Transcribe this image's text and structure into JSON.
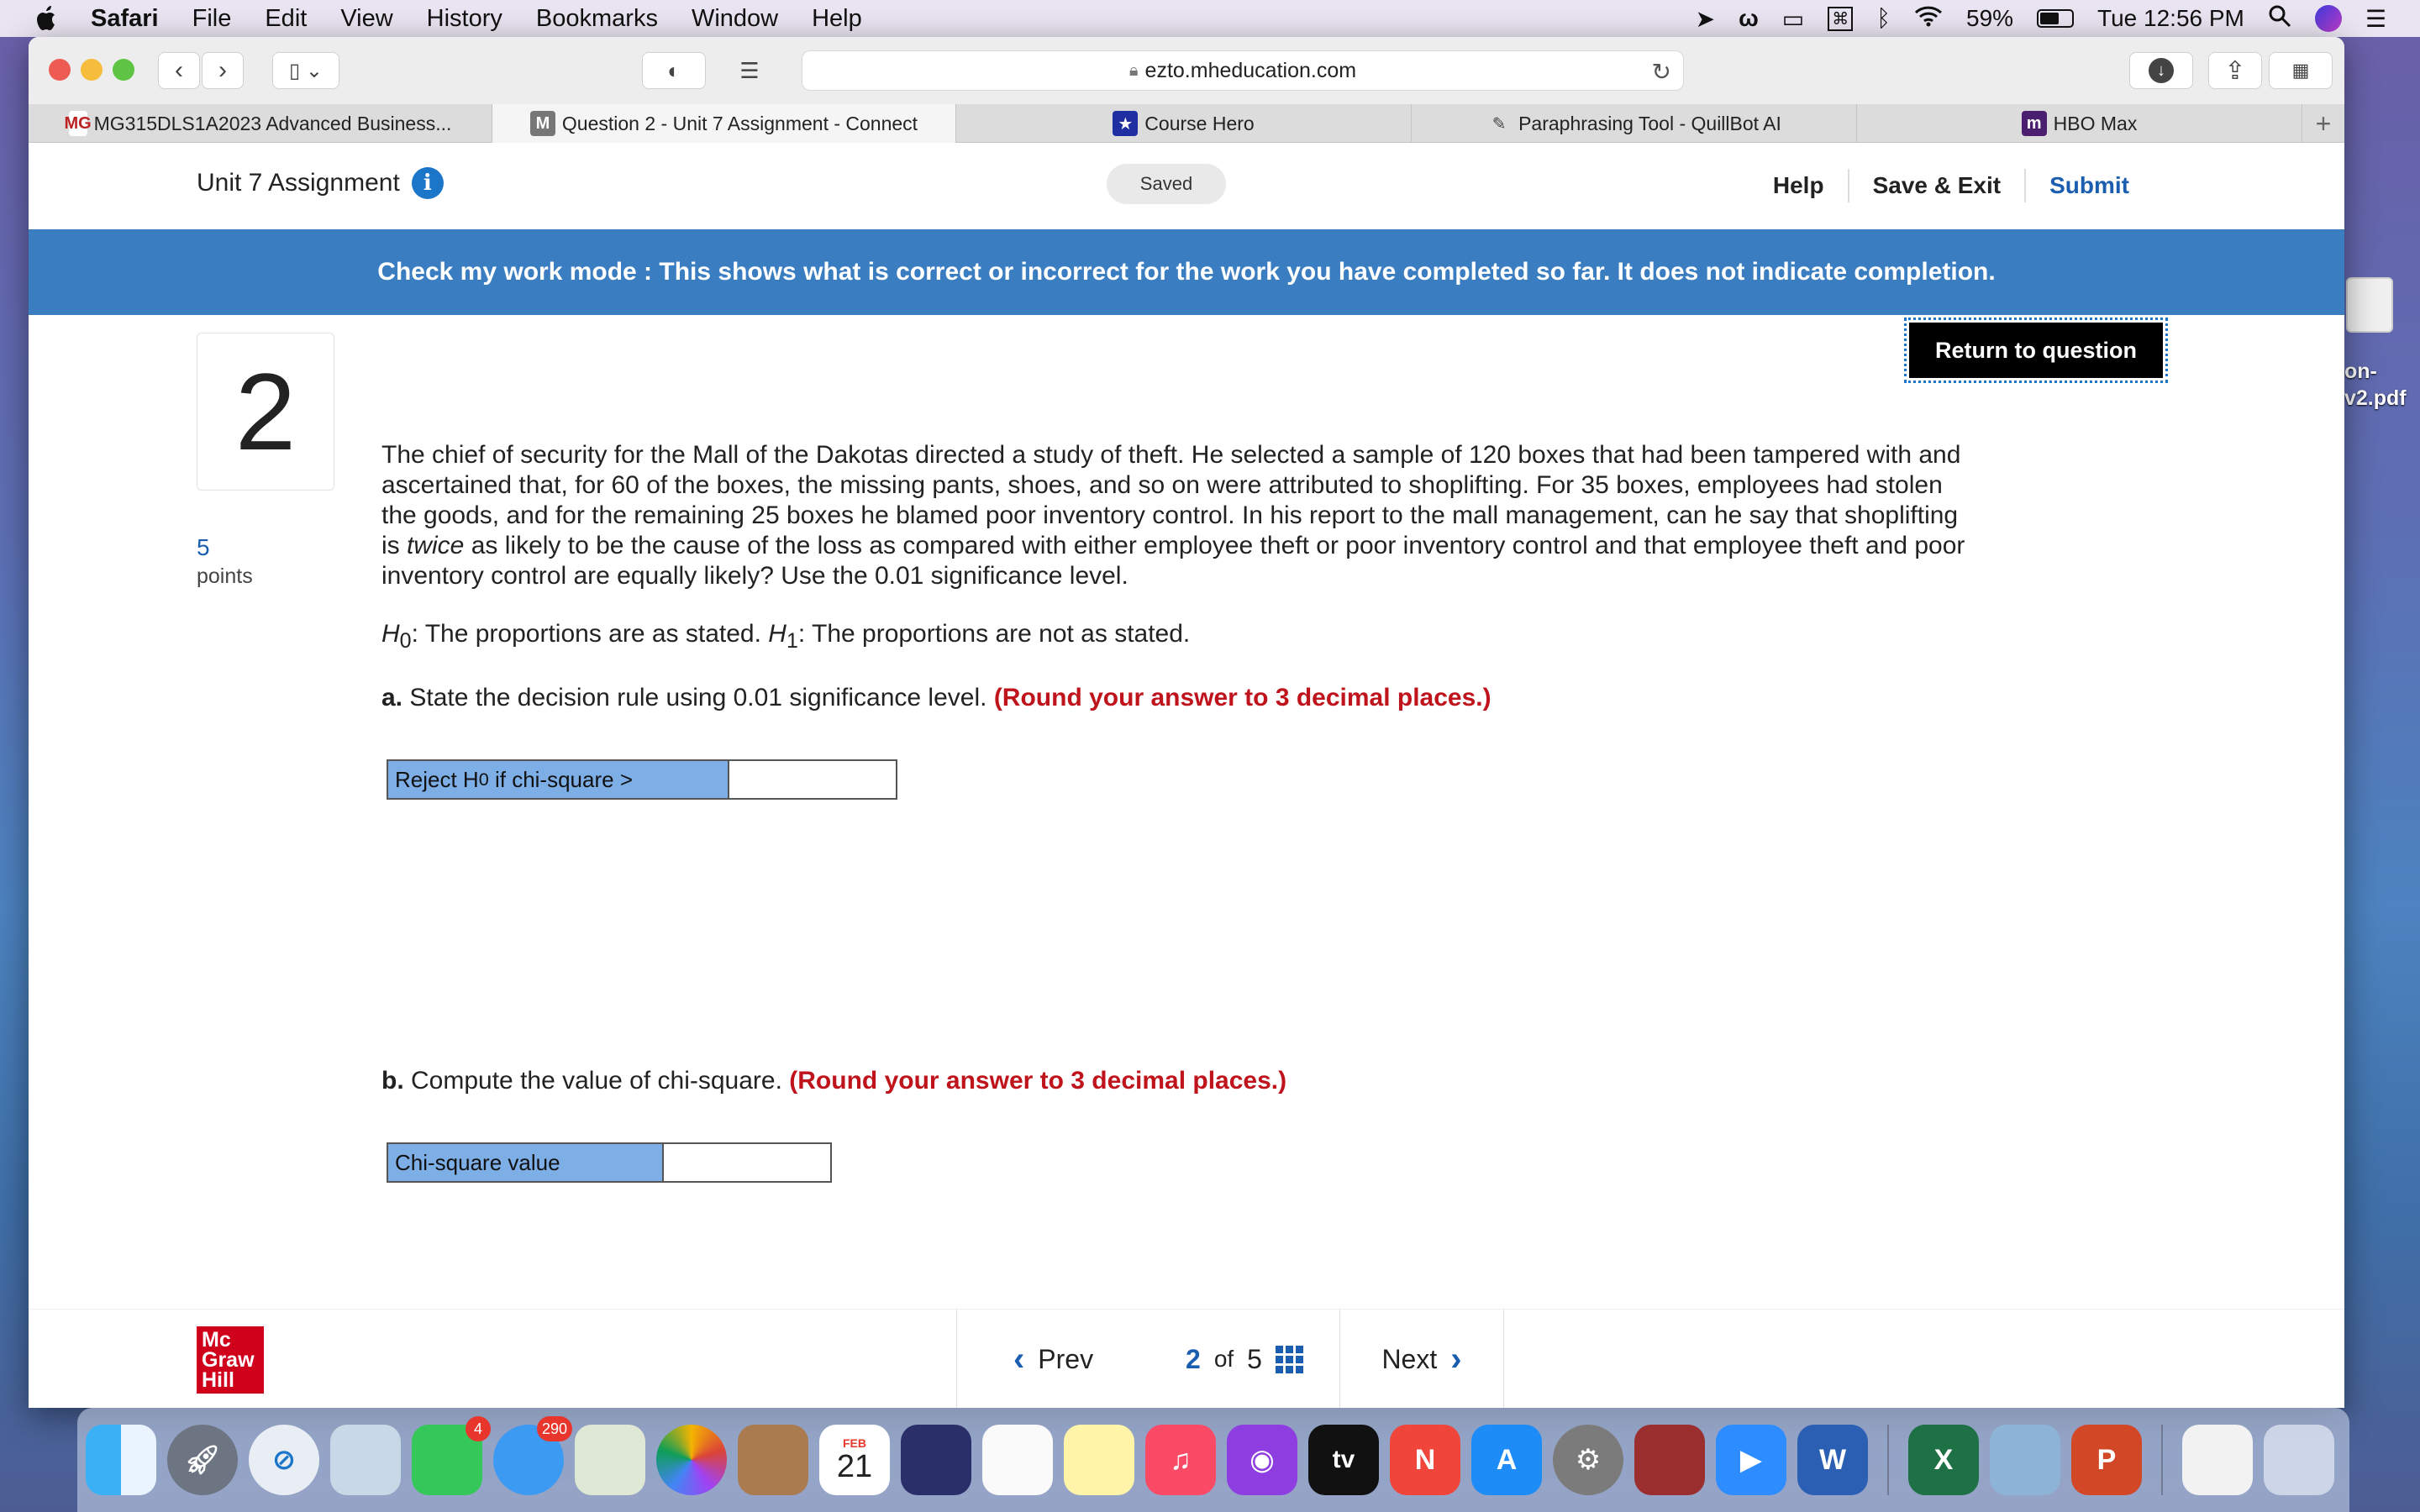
{
  "menubar": {
    "app": "Safari",
    "items": [
      "File",
      "Edit",
      "View",
      "History",
      "Bookmarks",
      "Window",
      "Help"
    ],
    "battery": "59%",
    "clock": "Tue 12:56 PM"
  },
  "desktop": {
    "edge_text_1": "on-",
    "edge_text_2": "v2.pdf"
  },
  "browser": {
    "url": "ezto.mheducation.com",
    "tabs": [
      {
        "label": "MG315DLS1A2023 Advanced Business...",
        "favicon": "MG"
      },
      {
        "label": "Question 2 - Unit 7 Assignment - Connect",
        "favicon": "M"
      },
      {
        "label": "Course Hero",
        "favicon": "★"
      },
      {
        "label": "Paraphrasing Tool - QuillBot AI",
        "favicon": "✎"
      },
      {
        "label": "HBO Max",
        "favicon": "m"
      }
    ]
  },
  "header": {
    "title": "Unit 7 Assignment",
    "info_glyph": "i",
    "saved": "Saved",
    "help": "Help",
    "save_exit": "Save & Exit",
    "submit": "Submit"
  },
  "banner": {
    "text": "Check my work mode : This shows what is correct or incorrect for the work you have completed so far. It does not indicate completion."
  },
  "question": {
    "number": "2",
    "points_value": "5",
    "points_label": "points",
    "return_button": "Return to question",
    "text_before": "The chief of security for the Mall of the Dakotas directed a study of theft. He selected a sample of 120 boxes that had been tampered with and ascertained that, for 60 of the boxes, the missing pants, shoes, and so on were attributed to shoplifting. For 35 boxes, employees had stolen the goods, and for the remaining 25 boxes he blamed poor inventory control. In his report to the mall management, can he say that shoplifting is",
    "text_emph": "twice",
    "text_after": "as likely to be the cause of the loss as compared with either employee theft or poor inventory control and that employee theft and poor inventory control are equally likely? Use the 0.01 significance level.",
    "h0_sym": "H",
    "h0_sub": "0",
    "h0_text": ": The proportions are as stated.",
    "h1_sym": "H",
    "h1_sub": "1",
    "h1_text": ": The proportions are not as stated."
  },
  "part_a": {
    "label": "a.",
    "text": "State the decision rule using 0.01 significance level.",
    "note": "(Round your answer to 3 decimal places.)",
    "row_label_pre": "Reject H",
    "row_label_sub": "0",
    "row_label_post": " if chi-square >",
    "value": ""
  },
  "part_b": {
    "label": "b.",
    "text": "Compute the value of chi-square.",
    "note": "(Round your answer to 3 decimal places.)",
    "row_label": "Chi-square value",
    "value": ""
  },
  "footer": {
    "logo_lines": [
      "Mc",
      "Graw",
      "Hill"
    ],
    "prev": "Prev",
    "page_current": "2",
    "page_of": "of",
    "page_total": "5",
    "next": "Next"
  },
  "dock": {
    "messages_badge": "4",
    "mail_badge": "290",
    "calendar_month": "FEB",
    "calendar_day": "21",
    "tv_label": "tv",
    "word_letter": "W",
    "excel_letter": "X",
    "ppt_letter": "P"
  }
}
